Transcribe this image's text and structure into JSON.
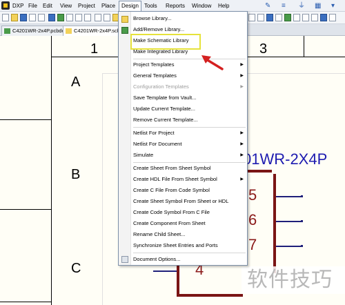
{
  "menubar": {
    "items": [
      {
        "label": "DXP"
      },
      {
        "label": "File"
      },
      {
        "label": "Edit"
      },
      {
        "label": "View"
      },
      {
        "label": "Project"
      },
      {
        "label": "Place"
      },
      {
        "label": "Design"
      },
      {
        "label": "Tools"
      },
      {
        "label": "Reports"
      },
      {
        "label": "Window"
      },
      {
        "label": "Help"
      }
    ]
  },
  "tabs": [
    {
      "label": "C4201WR-2x4P.pcbdoc"
    },
    {
      "label": "C4201WR-2x4P.schdoc"
    }
  ],
  "sheet": {
    "col_labels": [
      "1",
      "3"
    ],
    "row_labels": [
      "A",
      "B",
      "C"
    ],
    "component_title": "01WR-2X4P",
    "pins": [
      "5",
      "6",
      "7",
      "4"
    ]
  },
  "design_menu": {
    "items": [
      {
        "label": "Browse Library...",
        "disabled": false,
        "submenu": false
      },
      {
        "label": "Add/Remove Library...",
        "disabled": false,
        "submenu": false
      },
      {
        "label": "Make Schematic Library",
        "disabled": false,
        "submenu": false
      },
      {
        "label": "Make Integrated Library",
        "disabled": false,
        "submenu": false
      },
      {
        "label": "Project Templates",
        "disabled": false,
        "submenu": true
      },
      {
        "label": "General Templates",
        "disabled": false,
        "submenu": true
      },
      {
        "label": "Configuration Templates",
        "disabled": true,
        "submenu": true
      },
      {
        "label": "Save Template from Vault...",
        "disabled": false,
        "submenu": false
      },
      {
        "label": "Update Current Template...",
        "disabled": false,
        "submenu": false
      },
      {
        "label": "Remove Current Template...",
        "disabled": false,
        "submenu": false
      },
      {
        "label": "Netlist For Project",
        "disabled": false,
        "submenu": true
      },
      {
        "label": "Netlist For Document",
        "disabled": false,
        "submenu": true
      },
      {
        "label": "Simulate",
        "disabled": false,
        "submenu": true
      },
      {
        "label": "Create Sheet From Sheet Symbol",
        "disabled": false,
        "submenu": false
      },
      {
        "label": "Create HDL File From Sheet Symbol",
        "disabled": false,
        "submenu": true
      },
      {
        "label": "Create C File From Code Symbol",
        "disabled": false,
        "submenu": false
      },
      {
        "label": "Create Sheet Symbol From Sheet or HDL",
        "disabled": false,
        "submenu": false
      },
      {
        "label": "Create Code Symbol From C File",
        "disabled": false,
        "submenu": false
      },
      {
        "label": "Create Component From Sheet",
        "disabled": false,
        "submenu": false
      },
      {
        "label": "Rename Child Sheet...",
        "disabled": false,
        "submenu": false
      },
      {
        "label": "Synchronize Sheet Entries and Ports",
        "disabled": false,
        "submenu": false
      },
      {
        "label": "Document Options...",
        "disabled": false,
        "submenu": false
      }
    ],
    "submenu_glyph": "▶"
  },
  "watermark": {
    "text": "软件技巧"
  },
  "colors": {
    "highlight": "#e6e23a",
    "arrow": "#d42020",
    "component_title": "#1d1bb0",
    "component_body": "#7a1515"
  }
}
